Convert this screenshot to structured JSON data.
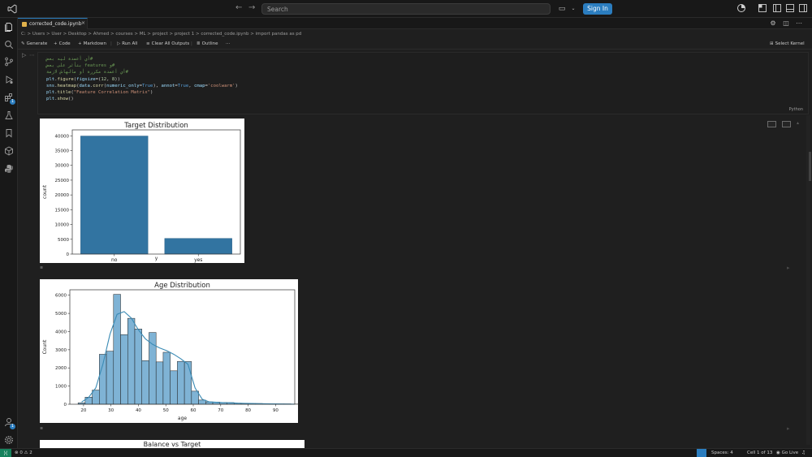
{
  "titlebar": {
    "search_placeholder": "Search",
    "sign_in_label": "Sign In",
    "colors": {
      "accent": "#2b7dbf",
      "background": "#181818"
    }
  },
  "activity_bar": {
    "items": [
      "explorer-icon",
      "search-icon",
      "source-control-icon",
      "run-debug-icon",
      "extensions-icon",
      "testing-icon",
      "bookmarks-icon",
      "remote-explorer-icon",
      "python-icon"
    ],
    "extensions_badge": "1",
    "accounts_badge": "1"
  },
  "tab": {
    "filename": "corrected_code.ipynb",
    "close": "×"
  },
  "breadcrumb": {
    "items": [
      "C:",
      "Users",
      "User",
      "Desktop",
      "Ahmed",
      "courses",
      "ML",
      "project",
      "project 1",
      "corrected_code.ipynb",
      "import pandas as pd"
    ],
    "separator": ">"
  },
  "toolbar": {
    "generate": "Generate",
    "code": "Code",
    "markdown": "Markdown",
    "run_all": "Run All",
    "clear_outputs": "Clear All Outputs",
    "outline": "Outline",
    "more": "···",
    "select_kernel": "Select Kernel"
  },
  "cell": {
    "language": "Python",
    "lines": [
      [
        {
          "t": "#أي أعمدة ليه بعض",
          "c": "cm"
        }
      ],
      [
        {
          "t": "#و features بتأثر على بعض",
          "c": "cm"
        }
      ],
      [
        {
          "t": "#أي أعمدة مكررة أو مالهاش لازمة",
          "c": "cm"
        }
      ],
      [
        {
          "t": "plt",
          "c": "id"
        },
        {
          "t": ".",
          "c": "pl"
        },
        {
          "t": "figure",
          "c": "fn"
        },
        {
          "t": "(",
          "c": "pl"
        },
        {
          "t": "figsize",
          "c": "id"
        },
        {
          "t": "=(",
          "c": "pl"
        },
        {
          "t": "12",
          "c": "num"
        },
        {
          "t": ", ",
          "c": "pl"
        },
        {
          "t": "8",
          "c": "num"
        },
        {
          "t": "))",
          "c": "pl"
        }
      ],
      [
        {
          "t": "sns",
          "c": "id"
        },
        {
          "t": ".",
          "c": "pl"
        },
        {
          "t": "heatmap",
          "c": "fn"
        },
        {
          "t": "(",
          "c": "pl"
        },
        {
          "t": "data",
          "c": "id"
        },
        {
          "t": ".",
          "c": "pl"
        },
        {
          "t": "corr",
          "c": "fn"
        },
        {
          "t": "(",
          "c": "pl"
        },
        {
          "t": "numeric_only",
          "c": "id"
        },
        {
          "t": "=",
          "c": "pl"
        },
        {
          "t": "True",
          "c": "kw"
        },
        {
          "t": "), ",
          "c": "pl"
        },
        {
          "t": "annot",
          "c": "id"
        },
        {
          "t": "=",
          "c": "pl"
        },
        {
          "t": "True",
          "c": "kw"
        },
        {
          "t": ", ",
          "c": "pl"
        },
        {
          "t": "cmap",
          "c": "id"
        },
        {
          "t": "=",
          "c": "pl"
        },
        {
          "t": "'coolwarm'",
          "c": "str"
        },
        {
          "t": ")",
          "c": "pl"
        }
      ],
      [
        {
          "t": "plt",
          "c": "id"
        },
        {
          "t": ".",
          "c": "pl"
        },
        {
          "t": "title",
          "c": "fn"
        },
        {
          "t": "(",
          "c": "pl"
        },
        {
          "t": "\"Feature Correlation Matrix\"",
          "c": "str"
        },
        {
          "t": ")",
          "c": "pl"
        }
      ],
      [
        {
          "t": "plt",
          "c": "id"
        },
        {
          "t": ".",
          "c": "pl"
        },
        {
          "t": "show",
          "c": "fn"
        },
        {
          "t": "()",
          "c": "pl"
        }
      ]
    ]
  },
  "chart_data": [
    {
      "type": "bar",
      "title": "Target Distribution",
      "xlabel": "y",
      "ylabel": "count",
      "categories": [
        "no",
        "yes"
      ],
      "values": [
        39922,
        5289
      ],
      "ylim": [
        0,
        42000
      ],
      "yticks": [
        0,
        5000,
        10000,
        15000,
        20000,
        25000,
        30000,
        35000,
        40000
      ],
      "color": "#3274a1",
      "grid": false
    },
    {
      "type": "bar",
      "title": "Age Distribution",
      "xlabel": "age",
      "ylabel": "Count",
      "bin_start": 18,
      "bin_width": 2.585,
      "counts": [
        80,
        390,
        780,
        2750,
        2920,
        6050,
        3830,
        4730,
        4140,
        2400,
        3950,
        2330,
        2860,
        1840,
        2360,
        2350,
        720,
        230,
        130,
        120,
        100,
        90,
        60,
        50,
        40,
        40,
        30,
        20,
        20,
        20,
        10
      ],
      "kde": [
        120,
        380,
        900,
        2200,
        3850,
        4950,
        5100,
        4750,
        4100,
        3600,
        3300,
        3100,
        2950,
        2750,
        2500,
        2200,
        900,
        280,
        130,
        110,
        90,
        80,
        60,
        50,
        40,
        30,
        25,
        20,
        15,
        10,
        5
      ],
      "xlim": [
        15,
        97
      ],
      "ylim": [
        0,
        6300
      ],
      "xticks": [
        20,
        30,
        40,
        50,
        60,
        70,
        80,
        90
      ],
      "yticks": [
        0,
        1000,
        2000,
        3000,
        4000,
        5000,
        6000
      ],
      "color": "#7fb3d5",
      "edge_color": "#1f1f1f",
      "kde_color": "#3a8bb5",
      "grid": false
    },
    {
      "type": "bar",
      "title": "Balance vs Target"
    }
  ],
  "statusbar": {
    "problems": "0",
    "warnings": "2",
    "spaces": "Spaces: 4",
    "cell_position": "Cell 1 of 13",
    "go_live": "Go Live"
  }
}
